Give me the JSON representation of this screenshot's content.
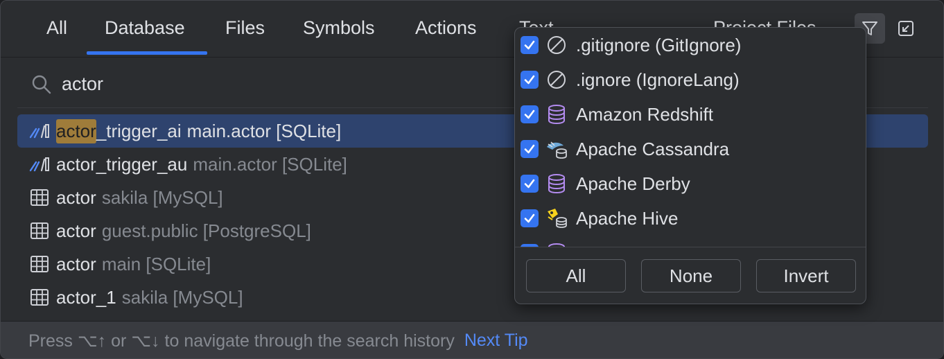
{
  "tabs": [
    {
      "label": "All"
    },
    {
      "label": "Database"
    },
    {
      "label": "Files"
    },
    {
      "label": "Symbols"
    },
    {
      "label": "Actions"
    },
    {
      "label": "Text"
    }
  ],
  "active_tab": "Database",
  "scope_label": "Project Files",
  "search": {
    "value": "actor",
    "icon": "search-icon"
  },
  "results": [
    {
      "icon": "trigger-icon",
      "highlight": "actor",
      "rest": "_trigger_ai",
      "location": "main.actor [SQLite]",
      "selected": true
    },
    {
      "icon": "trigger-icon",
      "highlight": "",
      "rest": "actor_trigger_au",
      "location": "main.actor [SQLite]",
      "selected": false
    },
    {
      "icon": "table-icon",
      "highlight": "",
      "rest": "actor",
      "location": "sakila [MySQL]",
      "selected": false
    },
    {
      "icon": "table-icon",
      "highlight": "",
      "rest": "actor",
      "location": "guest.public [PostgreSQL]",
      "selected": false
    },
    {
      "icon": "table-icon",
      "highlight": "",
      "rest": "actor",
      "location": "main [SQLite]",
      "selected": false
    },
    {
      "icon": "table-icon",
      "highlight": "",
      "rest": "actor_1",
      "location": "sakila [MySQL]",
      "selected": false
    }
  ],
  "footer": {
    "hint": "Press ⌥↑ or ⌥↓ to navigate through the search history",
    "link": "Next Tip"
  },
  "filter_popup": {
    "items": [
      {
        "label": ".gitignore (GitIgnore)",
        "checked": true,
        "icon": "ignore-icon"
      },
      {
        "label": ".ignore (IgnoreLang)",
        "checked": true,
        "icon": "ignore-icon"
      },
      {
        "label": "Amazon Redshift",
        "checked": true,
        "icon": "database-icon"
      },
      {
        "label": "Apache Cassandra",
        "checked": true,
        "icon": "cassandra-icon"
      },
      {
        "label": "Apache Derby",
        "checked": true,
        "icon": "database-icon"
      },
      {
        "label": "Apache Hive",
        "checked": true,
        "icon": "hive-icon"
      },
      {
        "label": "",
        "checked": true,
        "icon": "database-icon"
      }
    ],
    "buttons": {
      "all": "All",
      "none": "None",
      "invert": "Invert"
    }
  },
  "colors": {
    "accent": "#3574f0",
    "highlight": "#9f7c3a",
    "selection": "#2e436e",
    "link": "#548af7"
  }
}
